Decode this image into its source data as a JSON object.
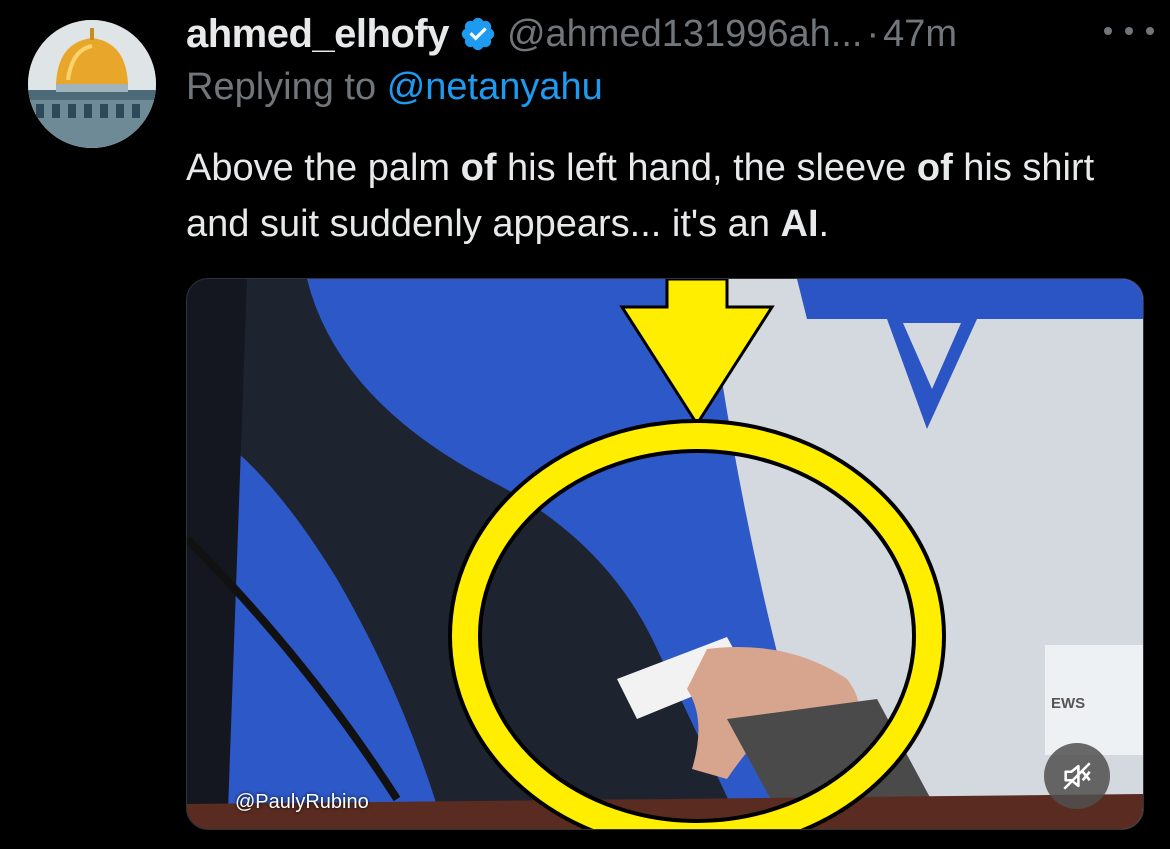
{
  "author": {
    "display_name": "ahmed_elhofy",
    "handle": "@ahmed131996ah...",
    "separator": "·",
    "time": "47m",
    "verified": true,
    "avatar_icon": "dome-of-the-rock-avatar"
  },
  "reply": {
    "prefix": "Replying to",
    "target": "@netanyahu"
  },
  "text": {
    "s1": "Above the palm ",
    "s2": "of",
    "s3": " his left hand, the sleeve ",
    "s4": "of",
    "s5": " his shirt and suit suddenly appears... it's an ",
    "s6": "AI",
    "s7": "."
  },
  "media": {
    "credit": "@PaulyRubino",
    "news_logo": "EWS",
    "annotation_color": "#ffee00",
    "mute_icon": "speaker-muted-icon"
  },
  "colors": {
    "link": "#1d9bf0",
    "secondary": "#71767b",
    "verified": "#1d9bf0"
  }
}
